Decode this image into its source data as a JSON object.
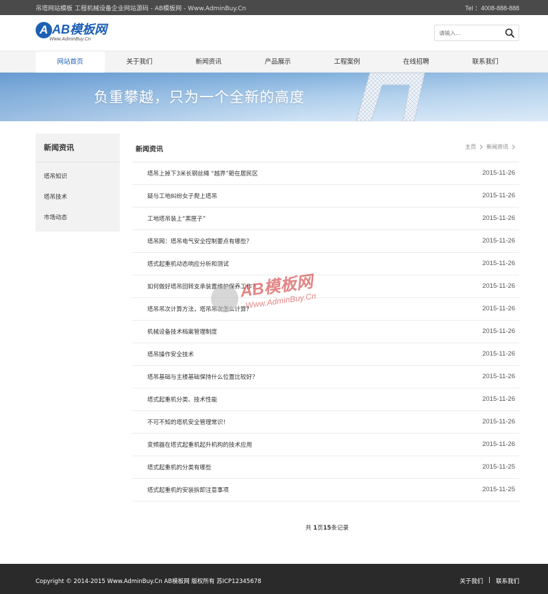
{
  "topbar": {
    "left_text": "吊塔网站模板 工程机械设备企业网站源码 - AB模板网 - Www.AdminBuy.Cn",
    "tel": "Tel ：4008-888-888"
  },
  "logo": {
    "mark": "A",
    "text": "AB模板网",
    "url": "Www.AdminBuy.Cn"
  },
  "search": {
    "placeholder": "请输入..."
  },
  "nav": {
    "items": [
      "网站首页",
      "关于我们",
      "新闻资讯",
      "产品展示",
      "工程案例",
      "在线招聘",
      "联系我们"
    ],
    "active_index": 0
  },
  "banner": {
    "slogan": "负重攀越，只为一个全新的高度"
  },
  "sidebar": {
    "title": "新闻资讯",
    "items": [
      "塔吊知识",
      "塔吊技术",
      "市场动态"
    ]
  },
  "main": {
    "title": "新闻资讯",
    "breadcrumb": [
      "主页",
      "新闻资讯"
    ],
    "news": [
      {
        "title": "塔吊上掉下3米长钢丝绳 “越界”砸在居民区",
        "date": "2015-11-26"
      },
      {
        "title": "疑与工地纠纷女子爬上塔吊",
        "date": "2015-11-26"
      },
      {
        "title": "工地塔吊装上“黑匣子”",
        "date": "2015-11-26"
      },
      {
        "title": "塔吊网：塔吊电气安全控制要点有哪些？",
        "date": "2015-11-26"
      },
      {
        "title": "塔式起重机动态响应分析和测试",
        "date": "2015-11-26"
      },
      {
        "title": "如何做好塔吊回转支承装置维护保养工作？",
        "date": "2015-11-26"
      },
      {
        "title": "塔吊吊次计算方法，塔吊吊次怎么计算？",
        "date": "2015-11-26"
      },
      {
        "title": "机械设备技术档案管理制度",
        "date": "2015-11-26"
      },
      {
        "title": "塔吊操作安全技术",
        "date": "2015-11-26"
      },
      {
        "title": "塔吊基础与主楼基础保持什么位置比较好？",
        "date": "2015-11-26"
      },
      {
        "title": "塔式起重机分类、技术性能",
        "date": "2015-11-26"
      },
      {
        "title": "不可不知的塔机安全管理常识！",
        "date": "2015-11-26"
      },
      {
        "title": "变频器在塔式起重机起升机构的技术应用",
        "date": "2015-11-26"
      },
      {
        "title": "塔式起重机的分类有哪些",
        "date": "2015-11-25"
      },
      {
        "title": "塔式起重机的安装拆卸注意事项",
        "date": "2015-11-25"
      }
    ],
    "pager": {
      "prefix": "共 ",
      "page": "1",
      "mid": "页",
      "total": "15",
      "suffix": "条记录"
    }
  },
  "watermark": {
    "text": "AB模板网",
    "url": "Www.AdminBuy.Cn"
  },
  "footer": {
    "copyright": "Copyright © 2014-2015 Www.AdminBuy.Cn AB模板网 版权所有    苏ICP12345678",
    "links": [
      "关于我们",
      "联系我们"
    ],
    "separator": "|"
  },
  "colors": {
    "topbar_bg": "#4a4a4a",
    "accent": "#1d5fb4",
    "footer_bg": "#2a2a2a"
  }
}
